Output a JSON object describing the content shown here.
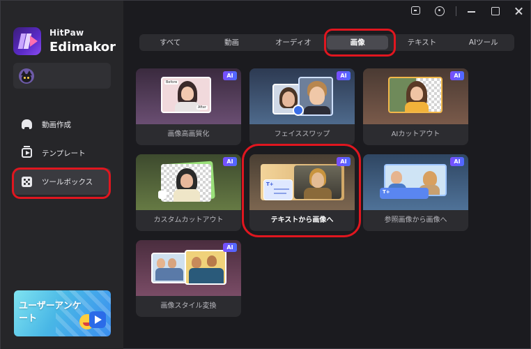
{
  "brand": {
    "line1": "HitPaw",
    "line2": "Edimakor"
  },
  "sidebar": {
    "items": [
      {
        "label": "動画作成"
      },
      {
        "label": "テンプレート"
      },
      {
        "label": "ツールボックス"
      }
    ],
    "promo_text": "ユーザーアンケート"
  },
  "tabs": [
    {
      "label": "すべて"
    },
    {
      "label": "動画"
    },
    {
      "label": "オーディオ"
    },
    {
      "label": "画像"
    },
    {
      "label": "テキスト"
    },
    {
      "label": "AIツール"
    }
  ],
  "cards": [
    {
      "label": "画像高画質化",
      "badge": "AI",
      "before": "Before",
      "after": "After"
    },
    {
      "label": "フェイススワップ",
      "badge": "AI"
    },
    {
      "label": "AIカットアウト",
      "badge": "AI"
    },
    {
      "label": "カスタムカットアウト",
      "badge": "AI"
    },
    {
      "label": "テキストから画像へ",
      "badge": "AI",
      "t_glyph": "T+"
    },
    {
      "label": "参照画像から画像へ",
      "badge": "AI",
      "t_glyph": "T+"
    },
    {
      "label": "画像スタイル変換",
      "badge": "AI"
    }
  ],
  "accent_colors": {
    "highlight": "#e0161f",
    "ai_badge": "#7b4dff",
    "active_tab": "#4a4a50"
  },
  "icons": [
    "feedback-icon",
    "info-icon",
    "minimize-icon",
    "maximize-icon",
    "close-icon",
    "home-icon",
    "template-icon",
    "toolbox-icon"
  ]
}
